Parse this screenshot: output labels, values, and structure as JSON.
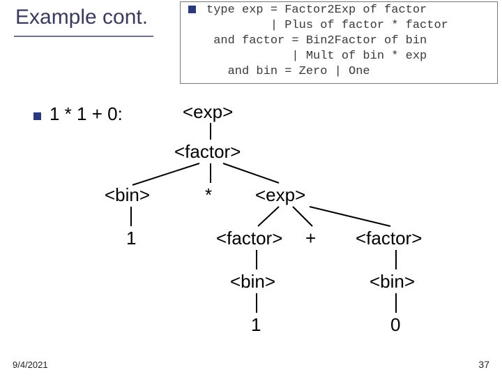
{
  "title": "Example cont.",
  "code": {
    "line1": "type exp = Factor2Exp of factor",
    "line2": "         | Plus of factor * factor",
    "line3": " and factor = Bin2Factor of bin",
    "line4": "            | Mult of bin * exp",
    "line5": "   and bin = Zero | One"
  },
  "expr_label": "1 * 1 + 0:",
  "tree": {
    "exp1": "<exp>",
    "factor1": "<factor>",
    "bin1": "<bin>",
    "star": "*",
    "exp2": "<exp>",
    "one1": "1",
    "factor2": "<factor>",
    "plus": "+",
    "factor3": "<factor>",
    "bin2": "<bin>",
    "bin3": "<bin>",
    "one2": "1",
    "zero": "0"
  },
  "footer": {
    "date": "9/4/2021",
    "page": "37"
  }
}
